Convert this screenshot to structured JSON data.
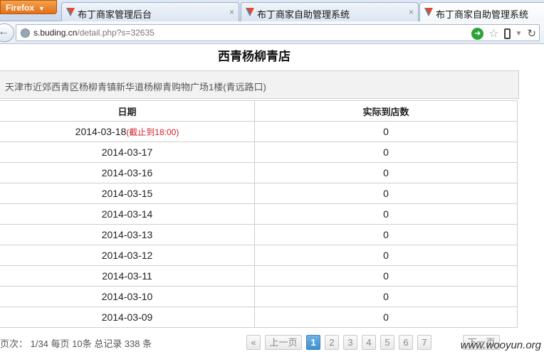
{
  "browser": {
    "firefox_label": "Firefox",
    "tabs": [
      {
        "label": "布丁商家管理后台"
      },
      {
        "label": "布丁商家自助管理系统"
      },
      {
        "label": "布丁商家自助管理系统"
      }
    ],
    "tab_close": "×",
    "url_host": "s.buding.cn",
    "url_path": "/detail.php?s=32635"
  },
  "page": {
    "title": "西青杨柳青店",
    "address": "天津市近郊西青区杨柳青镇新华道杨柳青购物广场1楼(青远路口)",
    "table": {
      "headers": [
        "日期",
        "实际到店数"
      ],
      "cutoff_note": "(截止到18:00)",
      "rows": [
        {
          "date": "2014-03-18",
          "count": "0"
        },
        {
          "date": "2014-03-17",
          "count": "0"
        },
        {
          "date": "2014-03-16",
          "count": "0"
        },
        {
          "date": "2014-03-15",
          "count": "0"
        },
        {
          "date": "2014-03-14",
          "count": "0"
        },
        {
          "date": "2014-03-13",
          "count": "0"
        },
        {
          "date": "2014-03-12",
          "count": "0"
        },
        {
          "date": "2014-03-11",
          "count": "0"
        },
        {
          "date": "2014-03-10",
          "count": "0"
        },
        {
          "date": "2014-03-09",
          "count": "0"
        }
      ]
    },
    "pager": {
      "info": "页次： 1/34 每页 10条 总记录 338 条",
      "first": "«",
      "prev": "上一页",
      "pages": [
        "1",
        "2",
        "3",
        "4",
        "5",
        "6",
        "7"
      ],
      "next": "下一页"
    },
    "watermark": "www.wooyun.org"
  }
}
